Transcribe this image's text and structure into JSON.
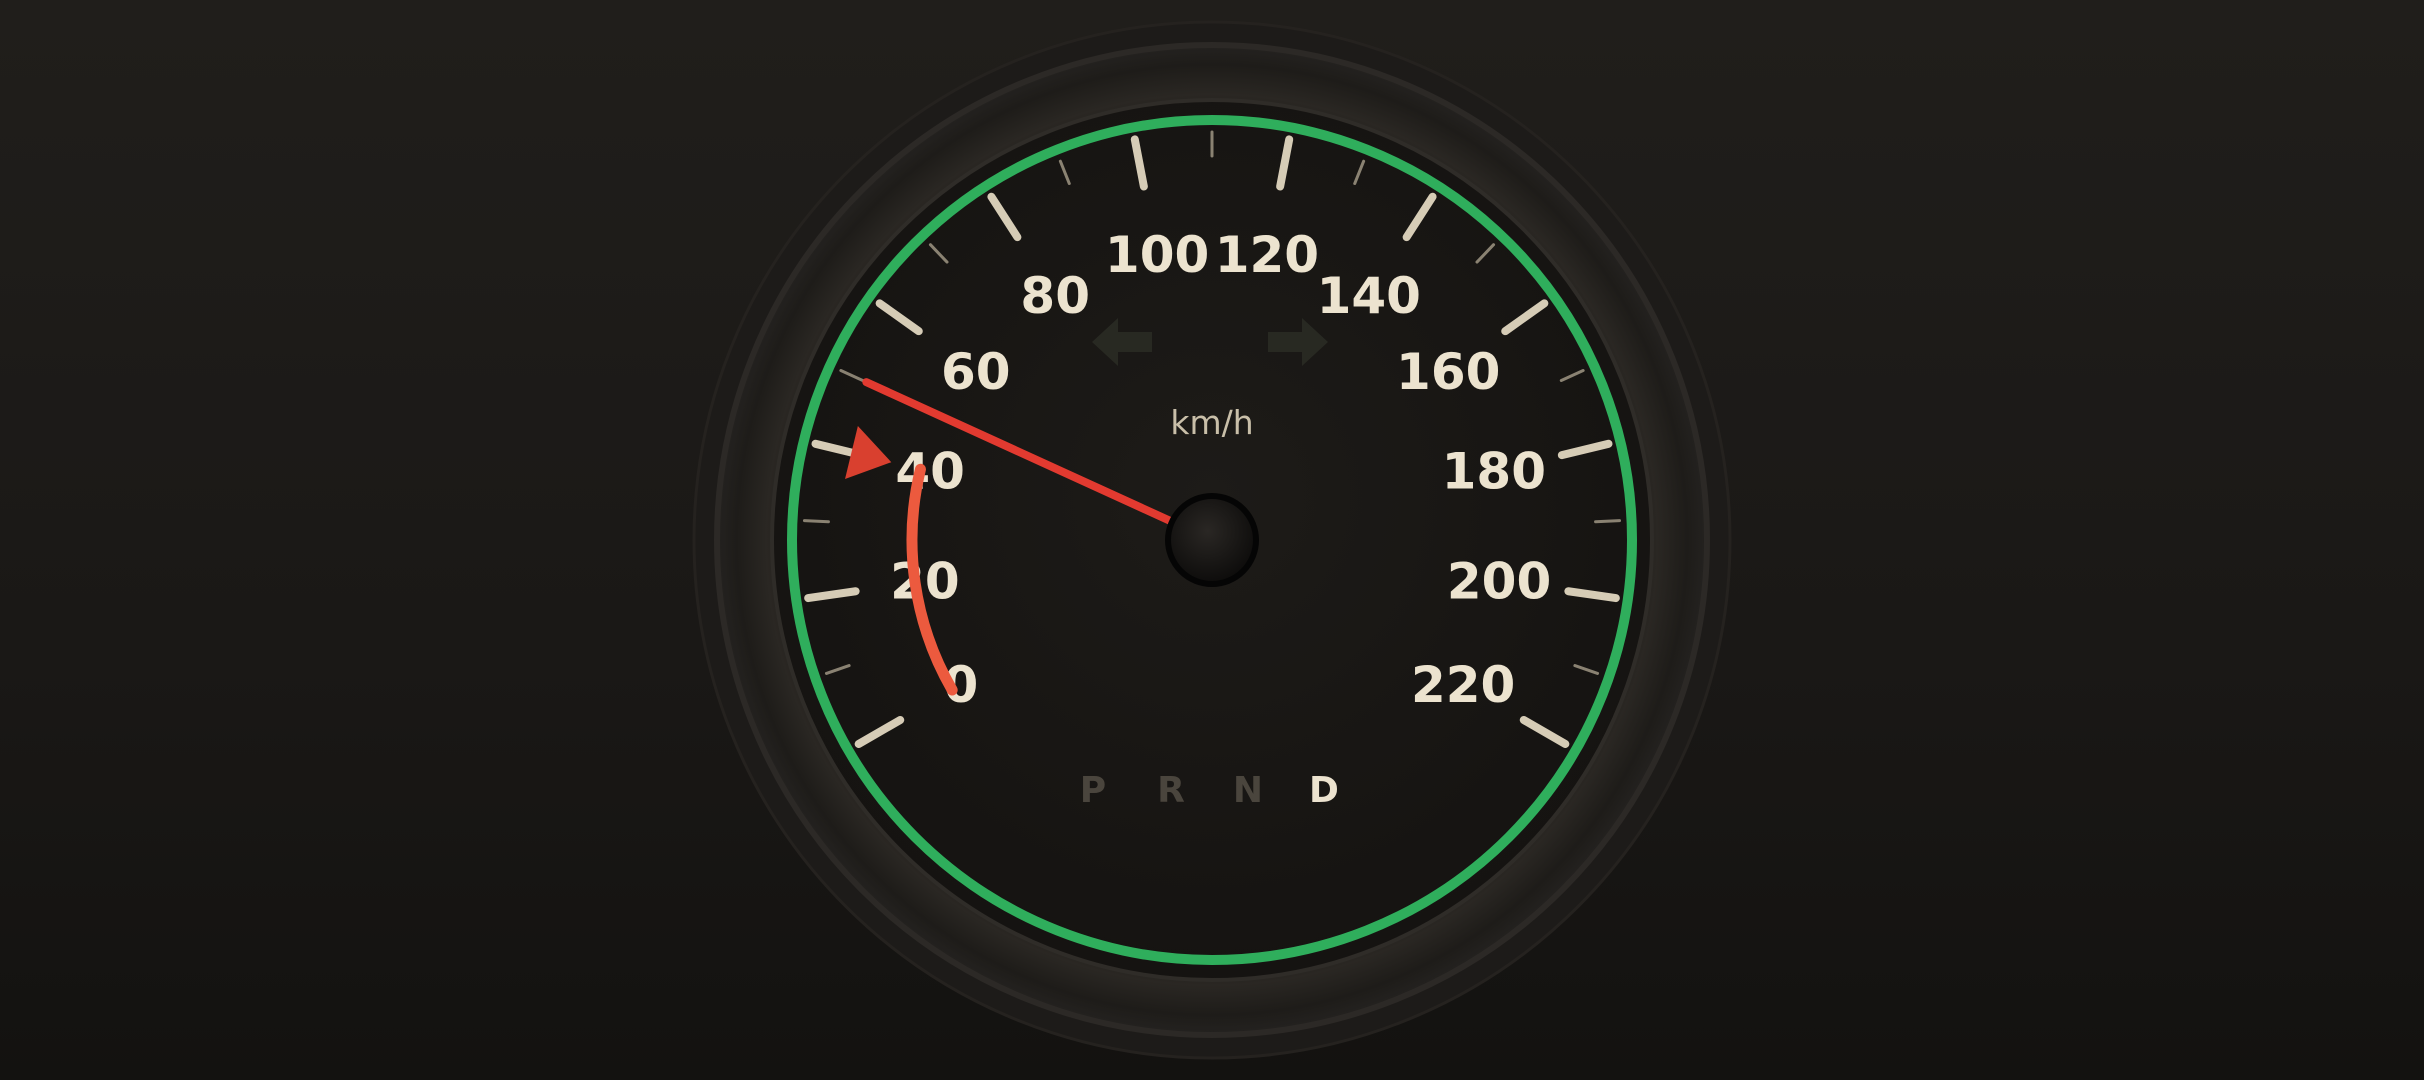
{
  "gauge": {
    "unit": "km/h",
    "speed": 50,
    "min": 0,
    "max": 220,
    "major_ticks": [
      0,
      20,
      40,
      60,
      80,
      100,
      120,
      140,
      160,
      180,
      200,
      220
    ],
    "tick_labels": [
      "0",
      "20",
      "40",
      "60",
      "80",
      "100",
      "120",
      "140",
      "160",
      "180",
      "200",
      "220"
    ],
    "set_speed": 40,
    "trail_start": 0,
    "trail_end": 40,
    "sweep_start_deg": 240,
    "sweep_end_deg": 480
  },
  "gears": {
    "items": [
      "P",
      "R",
      "N",
      "D"
    ],
    "active": "D"
  },
  "turn_signals": {
    "left": "left-arrow-icon",
    "right": "right-arrow-icon",
    "left_on": false,
    "right_on": false
  },
  "colors": {
    "ring": "#2fae5c",
    "needle": "#e23a30",
    "trail": "#ec5a3e",
    "marker": "#d9402f",
    "tick": "#d6ccb6",
    "label": "#ece3cf"
  }
}
